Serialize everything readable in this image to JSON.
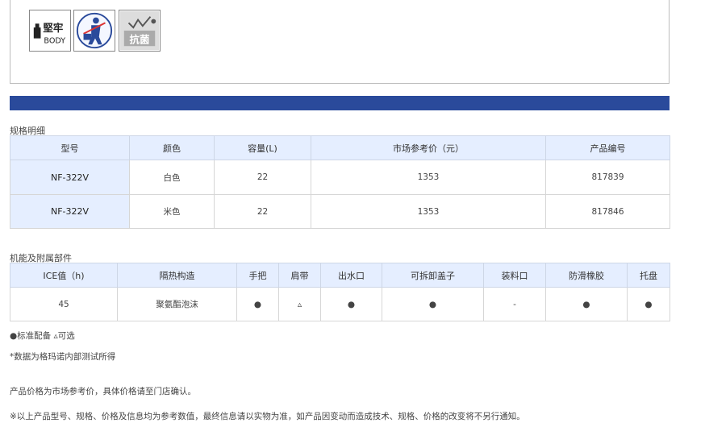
{
  "badges": [
    {
      "icon": "durable-body-icon",
      "cn": "堅牢",
      "en": "BODY"
    },
    {
      "icon": "shoulder-strap-person-icon",
      "cn": "",
      "en": ""
    },
    {
      "icon": "antibacterial-icon",
      "cn": "抗菌",
      "en": ""
    }
  ],
  "colors": {
    "accent": "#2a4a9b",
    "header_bg": "#e5eeff"
  },
  "spec": {
    "title": "规格明细",
    "headers": [
      "型号",
      "颜色",
      "容量(L)",
      "市场参考价（元）",
      "产品编号"
    ],
    "rows": [
      [
        "NF-322V",
        "白色",
        "22",
        "1353",
        "817839"
      ],
      [
        "NF-322V",
        "米色",
        "22",
        "1353",
        "817846"
      ]
    ]
  },
  "features": {
    "title": "机能及附属部件",
    "headers": [
      "ICE值（h)",
      "隔热构造",
      "手把",
      "肩带",
      "出水口",
      "可拆卸盖子",
      "装料口",
      "防滑橡胶",
      "托盘"
    ],
    "rows": [
      [
        "45",
        "聚氨酯泡沫",
        "●",
        "▵",
        "●",
        "●",
        "-",
        "●",
        "●"
      ]
    ]
  },
  "notes": {
    "legend": "●标准配备 ▵可选",
    "data_source": "*数据为格玛诺内部测试所得",
    "price_note": "产品价格为市场参考价，具体价格请至门店确认。",
    "disclaimer": "※以上产品型号、规格、价格及信息均为参考数值，最终信息请以实物为准，如产品因变动而造成技术、规格、价格的改变将不另行通知。"
  }
}
